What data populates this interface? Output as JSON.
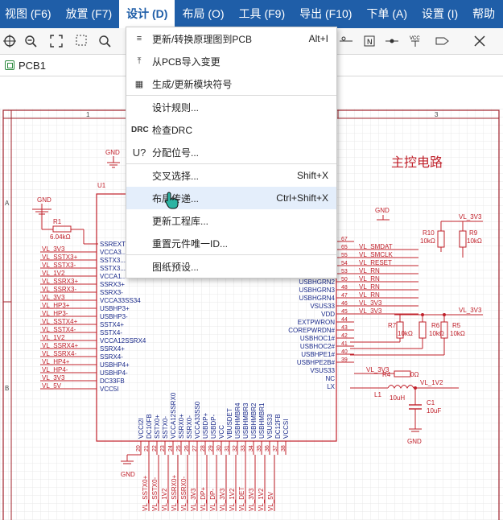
{
  "menubar": {
    "items": [
      {
        "label": "视图 (F6)"
      },
      {
        "label": "放置 (F7)"
      },
      {
        "label": "设计 (D)"
      },
      {
        "label": "布局 (O)"
      },
      {
        "label": "工具 (F9)"
      },
      {
        "label": "导出 (F10)"
      },
      {
        "label": "下单 (A)"
      },
      {
        "label": "设置 (I)"
      },
      {
        "label": "帮助"
      }
    ]
  },
  "toolbar": {
    "icons": [
      "crosshair-icon",
      "zoom-out-icon",
      "fit-icon",
      "zoom-area-icon",
      "search-icon",
      "pin-icon",
      "netflag-icon",
      "wire-icon",
      "vcc-icon",
      "netport-icon",
      "no-connect-icon"
    ]
  },
  "tab": {
    "label": "PCB1"
  },
  "design_menu": {
    "items": [
      {
        "icon": "≡",
        "label": "更新/转换原理图到PCB",
        "shortcut": "Alt+I"
      },
      {
        "icon": "⤒",
        "label": "从PCB导入变更",
        "shortcut": ""
      },
      {
        "icon": "▦",
        "label": "生成/更新模块符号",
        "shortcut": ""
      },
      {
        "icon": "",
        "label": "设计规则...",
        "shortcut": ""
      },
      {
        "icon": "DRC",
        "label": "检查DRC",
        "shortcut": ""
      },
      {
        "icon": "U?",
        "label": "分配位号...",
        "shortcut": ""
      },
      {
        "icon": "",
        "label": "交叉选择...",
        "shortcut": "Shift+X"
      },
      {
        "icon": "",
        "label": "布局传递...",
        "shortcut": "Ctrl+Shift+X"
      },
      {
        "icon": "",
        "label": "更新工程库...",
        "shortcut": ""
      },
      {
        "icon": "",
        "label": "重置元件唯一ID...",
        "shortcut": ""
      },
      {
        "icon": "",
        "label": "图纸预设...",
        "shortcut": ""
      }
    ]
  },
  "schematic": {
    "title": "主控电路",
    "ruler_top": [
      "1",
      "2",
      "3"
    ],
    "ruler_left": [
      "A",
      "B"
    ],
    "u1_label": "U1",
    "gnd": "GND",
    "r1": {
      "ref": "R1",
      "value": "6.04kΩ"
    },
    "left_nets": [
      "VL_3V3",
      "VL_SSTX3+",
      "VL_SSTX3-",
      "VL_1V2",
      "VL_SSRX3+",
      "VL_SSRX3-",
      "VL_3V3",
      "VL_HP3+",
      "VL_HP3-",
      "VL_SSTX4+",
      "VL_SSTX4-",
      "VL_1V2",
      "VL_SSRX4+",
      "VL_SSRX4-",
      "VL_HP4+",
      "VL_HP4-",
      "VL_3V3",
      "VL_5V"
    ],
    "left_pins": [
      "SSREXT",
      "VCCA3...",
      "SSTX3...",
      "SSTX3...",
      "VCCA1...",
      "SSRX3+",
      "SSRX3-",
      "VCCA33SS34",
      "USBHP3+",
      "USBHP3-",
      "SSTX4+",
      "SSTX4-",
      "VCCA12SSRX4",
      "SSRX4+",
      "SSRX4-",
      "USBHP4+",
      "USBHP4-",
      "DC33FB",
      "VCC5I"
    ],
    "right_pins": [
      "USBHGRN2",
      "USBHGRN3",
      "USBHGRN4",
      "VSUS33",
      "VDD",
      "EXTPWRON",
      "COREPWRDN#",
      "USBHOC1#",
      "USBHOC2#",
      "USBHPE1#",
      "USBHPE2B#",
      "VSUS33",
      "NC",
      "LX"
    ],
    "right_pin_nums": [
      "67",
      "65",
      "55",
      "54",
      "53",
      "50",
      "48",
      "47",
      "46",
      "45",
      "44",
      "43",
      "42",
      "41",
      "40",
      "39"
    ],
    "right_nets_top": [
      "VL_SMDAT",
      "VL_SMCLK",
      "VL_RESET",
      "VL_RN",
      "VL_RN",
      "VL_RN",
      "VL_RN",
      "VL_3V3",
      "VL_3V3"
    ],
    "r4": {
      "ref": "R4",
      "value": "0Ω",
      "net": "VL_3V3"
    },
    "l1": {
      "ref": "L1",
      "value": "10uH",
      "net": "VL_1V2"
    },
    "c1": {
      "ref": "C1",
      "value": "10uF"
    },
    "r_top": [
      {
        "ref": "R10",
        "value": "10kΩ"
      },
      {
        "ref": "R9",
        "value": "10kΩ"
      }
    ],
    "r_mid": [
      {
        "ref": "R7",
        "value": "10kΩ"
      },
      {
        "ref": "R6",
        "value": "10kΩ"
      },
      {
        "ref": "R5",
        "value": "10kΩ"
      }
    ],
    "vl_3v3": "VL_3V3",
    "bottom_pins": [
      "VCCI2I",
      "DC10FB",
      "SSTX0+",
      "SSTX0-",
      "VCCA12SSRX0",
      "SSRX0+",
      "SSRX0-",
      "VCCA33SS0",
      "USBDP+",
      "USBDP-",
      "VCC",
      "VBUSDET",
      "USBHMBR4",
      "USBHMBR3",
      "USBHMBR2",
      "USBHMBR1",
      "VSUS33",
      "DC12FB",
      "VCCSI"
    ],
    "bottom_nums": [
      "20",
      "21",
      "22",
      "23",
      "24",
      "25",
      "26",
      "27",
      "28",
      "29",
      "30",
      "31",
      "32",
      "33",
      "34",
      "35",
      "36",
      "37",
      "38"
    ],
    "bottom_nets": [
      "VL_SSTX0+",
      "VL_SSTX0-",
      "VL_1V2",
      "VL_SSRX0+",
      "VL_SSRX0-",
      "VL_3V3",
      "VL_DP+",
      "VL_DP-",
      "VL_3V3",
      "VL_1V2",
      "VL_DET",
      "VL_3V3",
      "VL_1V2",
      "VL_5V"
    ]
  }
}
